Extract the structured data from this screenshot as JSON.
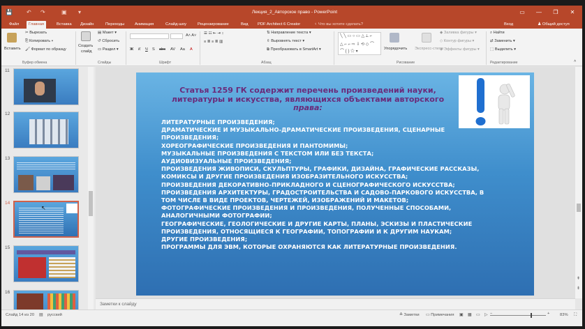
{
  "window": {
    "title": "Лекция_2_Авторское право - PowerPoint",
    "minimize_icon": "minimize-icon",
    "maximize_icon": "restore-icon",
    "close_icon": "close-icon"
  },
  "tabs": [
    "Файл",
    "Главная",
    "Вставка",
    "Дизайн",
    "Переходы",
    "Анимация",
    "Слайд-шоу",
    "Рецензирование",
    "Вид",
    "PDF Architect 6 Creator"
  ],
  "active_tab": "Главная",
  "tell_me": "Что вы хотите сделать?",
  "sign_in": "Вход",
  "share": "Общий доступ",
  "ribbon": {
    "clipboard": {
      "paste": "Вставить",
      "cut": "Вырезать",
      "copy": "Копировать",
      "format_painter": "Формат по образцу",
      "group": "Буфер обмена"
    },
    "slides": {
      "new_slide_1": "Создать",
      "new_slide_2": "слайд",
      "layout": "Макет",
      "reset": "Сбросить",
      "section": "Раздел",
      "group": "Слайды"
    },
    "font": {
      "group": "Шрифт",
      "bold": "Ж",
      "italic": "К",
      "underline": "Ч",
      "strike": "S",
      "abc": "abc",
      "spacing": "AV",
      "case": "Aa",
      "color": "A"
    },
    "paragraph": {
      "text_direction": "Направление текста",
      "align_text": "Выровнять текст",
      "smartart": "Преобразовать в SmartArt",
      "group": "Абзац"
    },
    "drawing": {
      "arrange": "Упорядочить",
      "quick_styles": "Экспресс-стили",
      "fill": "Заливка фигуры",
      "outline": "Контур фигуры",
      "effects": "Эффекты фигуры",
      "group": "Рисование"
    },
    "editing": {
      "find": "Найти",
      "replace": "Заменить",
      "select": "Выделить",
      "group": "Редактирование"
    }
  },
  "thumbnails": [
    {
      "num": "11",
      "selected": false
    },
    {
      "num": "12",
      "selected": false
    },
    {
      "num": "13",
      "selected": false
    },
    {
      "num": "14",
      "selected": true
    },
    {
      "num": "15",
      "selected": false
    },
    {
      "num": "16",
      "selected": false
    }
  ],
  "slide": {
    "title_line1": "Статья 1259 ГК содержит перечень произведений науки,",
    "title_line2": "литературы и искусства, являющихся объектами авторского",
    "title_line3": "права:",
    "items": [
      "ЛИТЕРАТУРНЫЕ ПРОИЗВЕДЕНИЯ;",
      "ДРАМАТИЧЕСКИЕ И МУЗЫКАЛЬНО-ДРАМАТИЧЕСКИЕ ПРОИЗВЕДЕНИЯ, СЦЕНАРНЫЕ",
      "ПРОИЗВЕДЕНИЯ;",
      "ХОРЕОГРАФИЧЕСКИЕ ПРОИЗВЕДЕНИЯ И ПАНТОМИМЫ;",
      "МУЗЫКАЛЬНЫЕ ПРОИЗВЕДЕНИЯ С ТЕКСТОМ ИЛИ БЕЗ ТЕКСТА;",
      "АУДИОВИЗУАЛЬНЫЕ ПРОИЗВЕДЕНИЯ;",
      "ПРОИЗВЕДЕНИЯ ЖИВОПИСИ, СКУЛЬПТУРЫ, ГРАФИКИ, ДИЗАЙНА, ГРАФИЧЕСКИЕ РАССКАЗЫ,",
      "КОМИКСЫ И ДРУГИЕ ПРОИЗВЕДЕНИЯ ИЗОБРАЗИТЕЛЬНОГО ИСКУССТВА;",
      "ПРОИЗВЕДЕНИЯ ДЕКОРАТИВНО-ПРИКЛАДНОГО И СЦЕНОГРАФИЧЕСКОГО ИСКУССТВА;",
      "ПРОИЗВЕДЕНИЯ АРХИТЕКТУРЫ, ГРАДОСТРОИТЕЛЬСТВА И САДОВО-ПАРКОВОГО ИСКУССТВА, В",
      "ТОМ ЧИСЛЕ В ВИДЕ ПРОЕКТОВ, ЧЕРТЕЖЕЙ, ИЗОБРАЖЕНИЙ И МАКЕТОВ;",
      "ФОТОГРАФИЧЕСКИЕ ПРОИЗВЕДЕНИЯ И ПРОИЗВЕДЕНИЯ, ПОЛУЧЕННЫЕ СПОСОБАМИ,",
      "АНАЛОГИЧНЫМИ ФОТОГРАФИИ;",
      "ГЕОГРАФИЧЕСКИЕ, ГЕОЛОГИЧЕСКИЕ И ДРУГИЕ КАРТЫ, ПЛАНЫ, ЭСКИЗЫ И ПЛАСТИЧЕСКИЕ",
      "ПРОИЗВЕДЕНИЯ, ОТНОСЯЩИЕСЯ К ГЕОГРАФИИ, ТОПОГРАФИИ И К ДРУГИМ НАУКАМ;",
      "ДРУГИЕ ПРОИЗВЕДЕНИЯ;",
      "ПРОГРАММЫ ДЛЯ ЭВМ, КОТОРЫЕ ОХРАНЯЮТСЯ КАК ЛИТЕРАТУРНЫЕ ПРОИЗВЕДЕНИЯ."
    ],
    "picture_icon": "exclamation-figure-icon"
  },
  "notes_placeholder": "Заметки к слайду",
  "status": {
    "slide_info": "Слайд 14 из 20",
    "language": "русский",
    "notes": "Заметки",
    "comments": "Примечания",
    "zoom": "83%"
  },
  "colors": {
    "accent": "#b7472a",
    "title_purple": "#6a2a7a",
    "selected_thumb": "#d0614a"
  }
}
